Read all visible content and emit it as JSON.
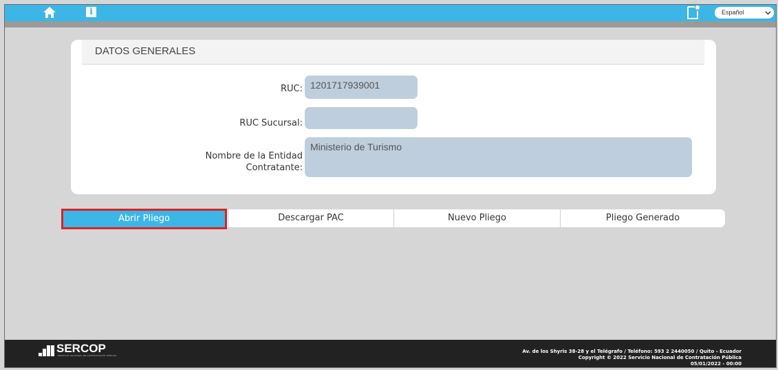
{
  "topbar": {
    "language": "Español",
    "accent": "#3cb6e6"
  },
  "panel": {
    "title": "DATOS GENERALES",
    "fields": {
      "ruc_label": "RUC:",
      "ruc_value": "1201717939001",
      "ruc_sucursal_label": "RUC Sucursal:",
      "ruc_sucursal_value": "",
      "entidad_label_line1": "Nombre de la Entidad",
      "entidad_label_line2": "Contratante:",
      "entidad_value": "Ministerio de Turismo"
    }
  },
  "tabs": [
    {
      "label": "Abrir Pliego",
      "active": true
    },
    {
      "label": "Descargar PAC"
    },
    {
      "label": "Nuevo Pliego"
    },
    {
      "label": "Pliego Generado"
    }
  ],
  "footer": {
    "logo": "SERCOP",
    "logo_sub": "SERVICIO NACIONAL DE CONTRATACIÓN PÚBLICA",
    "address": "Av. de los Shyris 38-28 y el Telégrafo / Teléfono: 593 2 2440050 / Quito - Ecuador",
    "copyright": "Copyright © 2022 Servicio Nacional de Contratación Pública",
    "date": "05/01/2022 - 00:00"
  }
}
